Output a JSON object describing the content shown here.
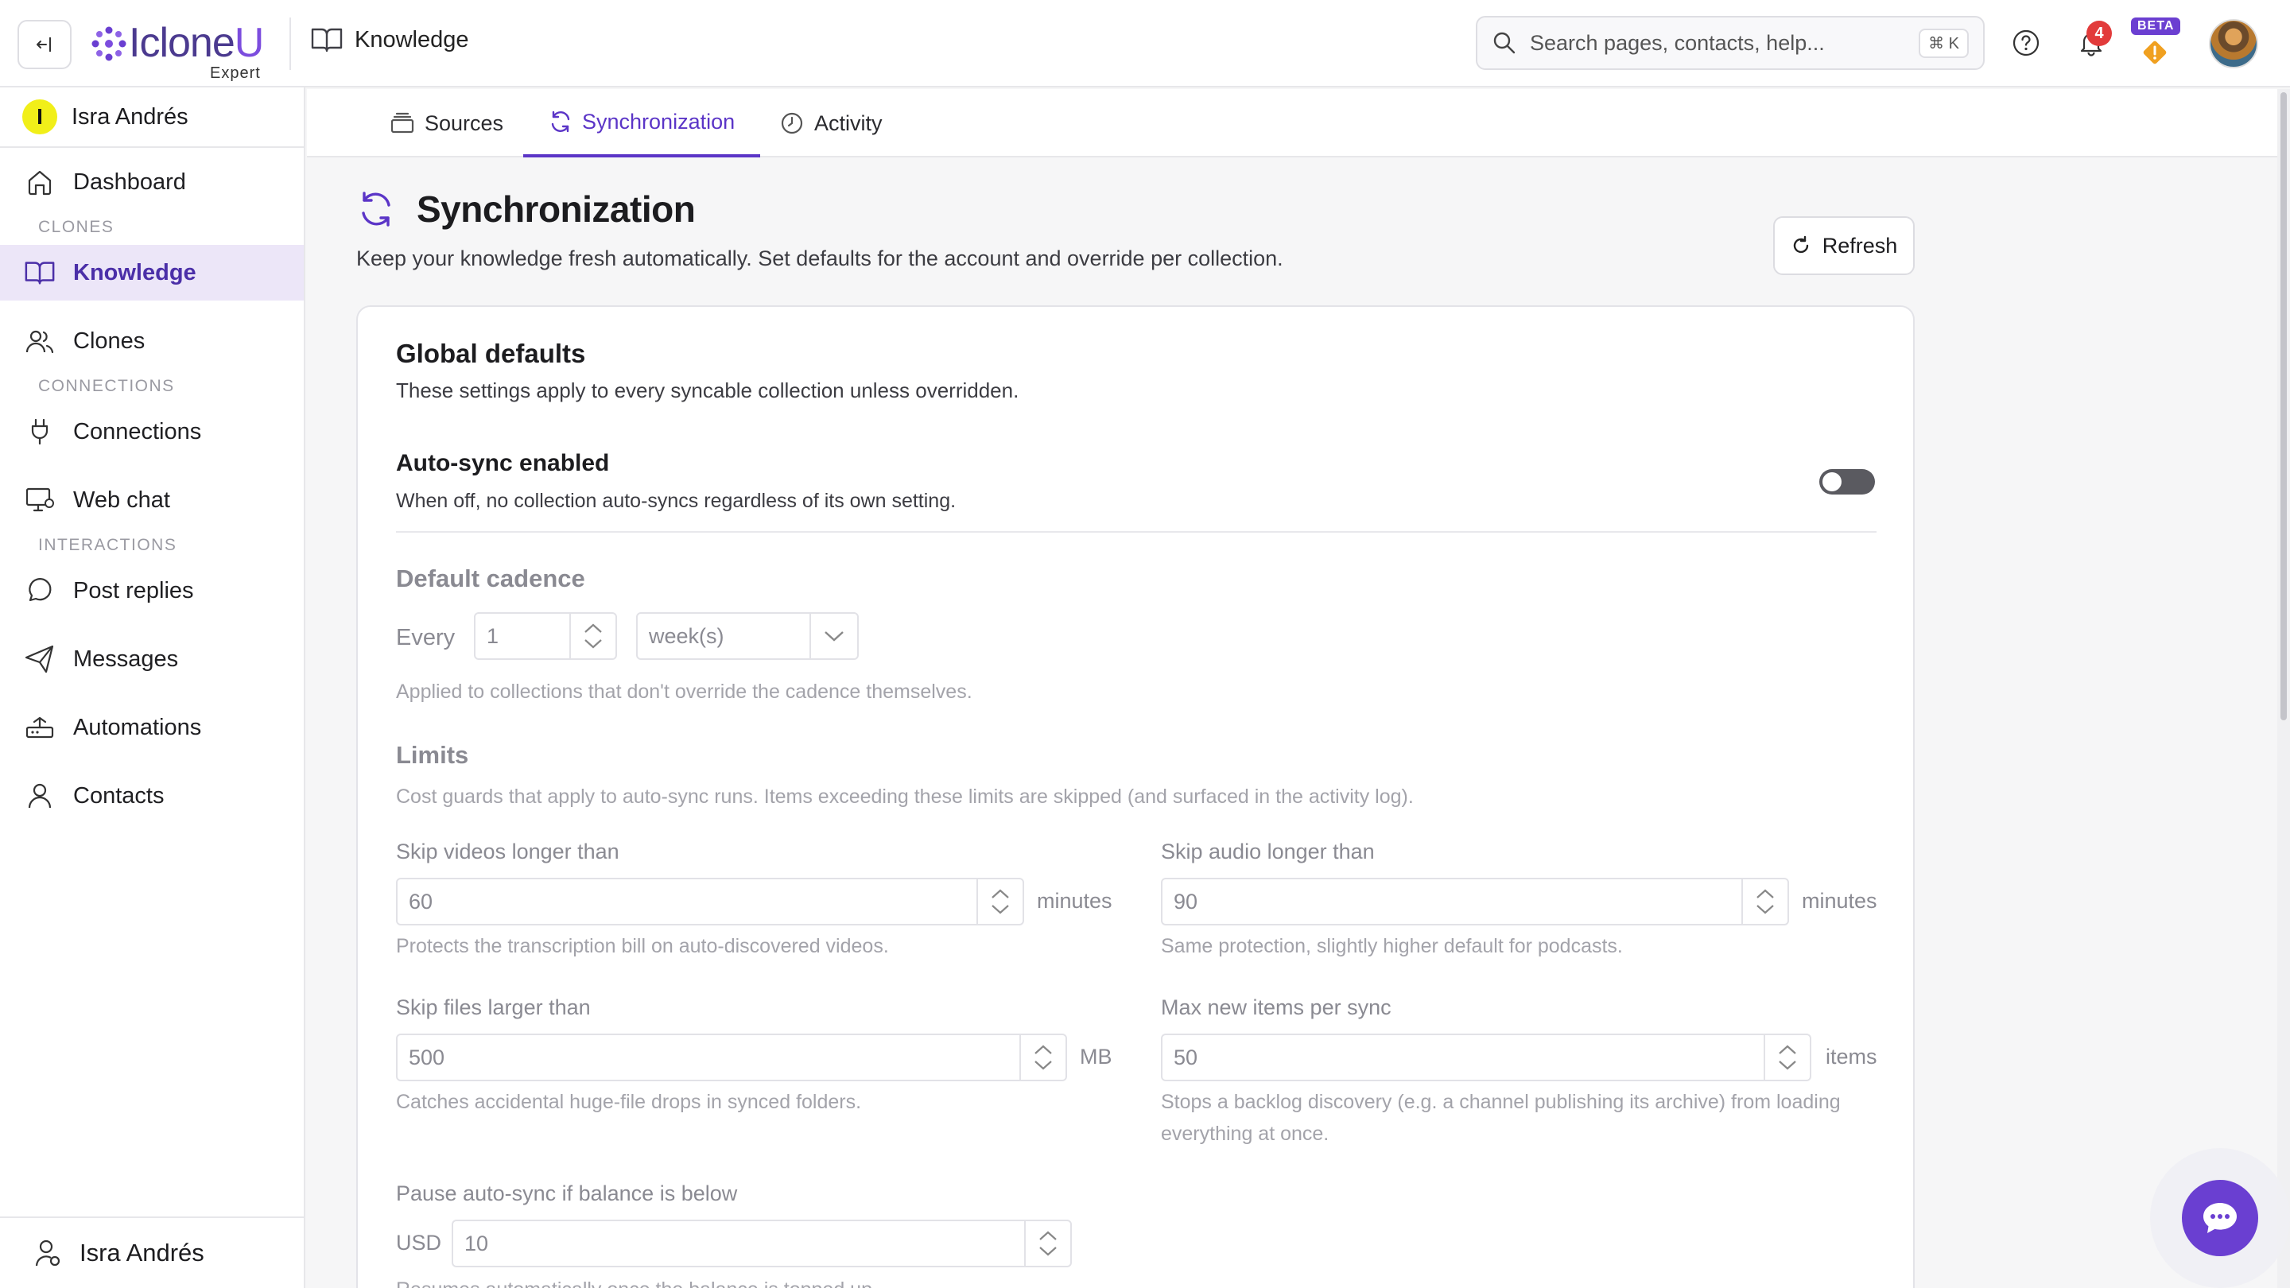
{
  "brand": {
    "name_prefix": "Iclone",
    "name_suffix": "U",
    "tier": "Expert"
  },
  "header": {
    "section": "Knowledge",
    "search_placeholder": "Search pages, contacts, help...",
    "search_shortcut": "⌘ K",
    "notification_count": "4",
    "beta_label": "BETA"
  },
  "sidebar": {
    "user_initial": "I",
    "user_name": "Isra Andrés",
    "items": [
      {
        "label": "Dashboard"
      },
      {
        "section": "CLONES"
      },
      {
        "label": "Knowledge"
      },
      {
        "label": "Clones"
      },
      {
        "section": "CONNECTIONS"
      },
      {
        "label": "Connections"
      },
      {
        "label": "Web chat"
      },
      {
        "section": "INTERACTIONS"
      },
      {
        "label": "Post replies"
      },
      {
        "label": "Messages"
      },
      {
        "label": "Automations"
      },
      {
        "label": "Contacts"
      }
    ],
    "footer_user": "Isra Andrés"
  },
  "tabs": [
    {
      "label": "Sources"
    },
    {
      "label": "Synchronization"
    },
    {
      "label": "Activity"
    }
  ],
  "page": {
    "title": "Synchronization",
    "subtitle": "Keep your knowledge fresh automatically. Set defaults for the account and override per collection.",
    "refresh_label": "Refresh"
  },
  "global": {
    "title": "Global defaults",
    "subtitle": "These settings apply to every syncable collection unless overridden.",
    "autosync_title": "Auto-sync enabled",
    "autosync_desc": "When off, no collection auto-syncs regardless of its own setting.",
    "autosync_on": false
  },
  "cadence": {
    "title": "Default cadence",
    "every_label": "Every",
    "value": "1",
    "unit": "week(s)",
    "help": "Applied to collections that don't override the cadence themselves."
  },
  "limits": {
    "title": "Limits",
    "help": "Cost guards that apply to auto-sync runs. Items exceeding these limits are skipped (and surfaced in the activity log).",
    "videos": {
      "label": "Skip videos longer than",
      "value": "60",
      "unit": "minutes",
      "help": "Protects the transcription bill on auto-discovered videos."
    },
    "audio": {
      "label": "Skip audio longer than",
      "value": "90",
      "unit": "minutes",
      "help": "Same protection, slightly higher default for podcasts."
    },
    "files": {
      "label": "Skip files larger than",
      "value": "500",
      "unit": "MB",
      "help": "Catches accidental huge-file drops in synced folders."
    },
    "items": {
      "label": "Max new items per sync",
      "value": "50",
      "unit": "items",
      "help_line1": "Stops a backlog discovery (e.g. a channel publishing its archive) from loading",
      "help_line2": "everything at once."
    },
    "balance": {
      "label": "Pause auto-sync if balance is below",
      "currency": "USD",
      "value": "10",
      "help": "Resumes automatically once the balance is topped up."
    }
  }
}
